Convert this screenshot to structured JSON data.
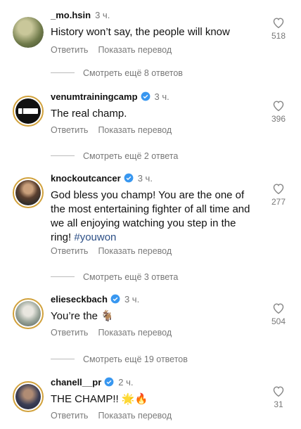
{
  "ui": {
    "reply_label": "Ответить",
    "translate_label": "Показать перевод"
  },
  "comments": [
    {
      "username": "_mo.hsin",
      "time": "3 ч.",
      "text": "History won’t say, the people will know",
      "likes": "518",
      "verified": false
    },
    {
      "username": "venumtrainingcamp",
      "time": "3 ч.",
      "text": "The real champ.",
      "likes": "396",
      "verified": true
    },
    {
      "username": "knockoutcancer",
      "time": "3 ч.",
      "text_lines": [
        "God bless you champ! You are the one of",
        "the most entertaining fighter of all time and",
        "we all enjoying watching you step in the",
        "ring! "
      ],
      "hashtag": "#youwon",
      "likes": "277",
      "verified": true
    },
    {
      "username": "elieseckbach",
      "time": "3 ч.",
      "text": "You’re the 🐐",
      "likes": "504",
      "verified": true
    },
    {
      "username": "chanell__pr",
      "time": "2 ч.",
      "text": "THE CHAMP!! 🌟🔥",
      "likes": "31",
      "verified": true
    }
  ],
  "more_replies": [
    "Смотреть ещё 8 ответов",
    "Смотреть ещё 2 ответа",
    "Смотреть ещё 3 ответа",
    "Смотреть ещё 19 ответов"
  ],
  "colors": {
    "verified": "#3897f0",
    "muted": "#777777",
    "hashtag": "#2c4f86"
  }
}
